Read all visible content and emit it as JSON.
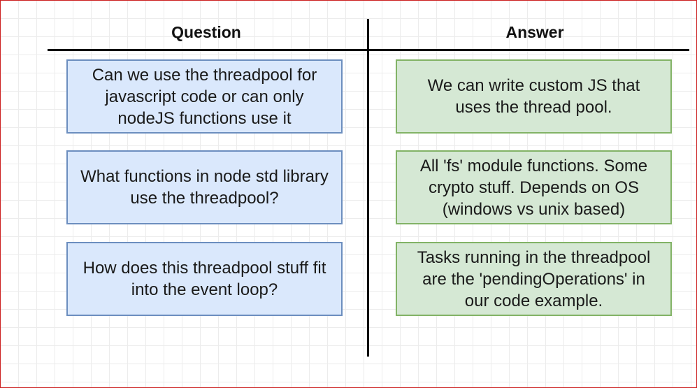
{
  "columns": {
    "question": "Question",
    "answer": "Answer"
  },
  "rows": [
    {
      "question": [
        "Can we use the threadpool for",
        "javascript code or can only",
        "nodeJS functions use it"
      ],
      "answer": [
        "We can write custom JS that",
        "uses the thread pool."
      ]
    },
    {
      "question": [
        "What functions in node std library",
        "use the threadpool?"
      ],
      "answer": [
        "All 'fs' module functions.  Some",
        "crypto stuff.  Depends on OS",
        "(windows vs unix based)"
      ]
    },
    {
      "question": [
        "How does this threadpool stuff fit",
        "into the event loop?"
      ],
      "answer": [
        "Tasks running in the threadpool",
        "are the 'pendingOperations' in",
        "our code example."
      ]
    }
  ],
  "colors": {
    "question_fill": "#dae8fc",
    "question_border": "#6c8ebf",
    "answer_fill": "#d5e8d4",
    "answer_border": "#82b366"
  }
}
